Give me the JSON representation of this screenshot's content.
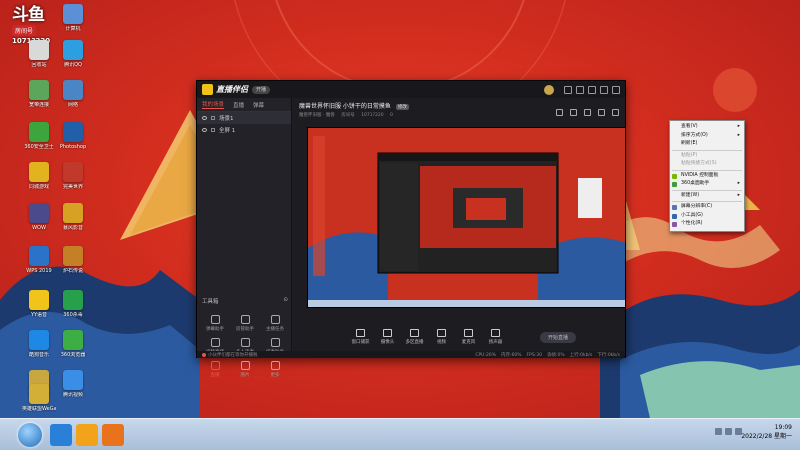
{
  "overlay": {
    "brand": "斗鱼",
    "room_tag": "房间号",
    "room_number": "1071?220"
  },
  "desktop_icons": [
    {
      "label": "计算机",
      "color": "#5b8fd6"
    },
    {
      "label": "回收站",
      "color": "#d9d9d9"
    },
    {
      "label": "腾讯QQ",
      "color": "#2d9ee0"
    },
    {
      "label": "宽带连接",
      "color": "#5aa65a"
    },
    {
      "label": "网络",
      "color": "#4a86c6"
    },
    {
      "label": "360安全卫士",
      "color": "#3ca53c"
    },
    {
      "label": "Photoshop",
      "color": "#2160a8"
    },
    {
      "label": "同城游戏",
      "color": "#e0b31f"
    },
    {
      "label": "完美世界",
      "color": "#c0392b"
    },
    {
      "label": "WOW",
      "color": "#4a4a8c"
    },
    {
      "label": "暴风影音",
      "color": "#d7a223"
    },
    {
      "label": "WPS 2019",
      "color": "#2a73c9"
    },
    {
      "label": "炉石传说",
      "color": "#c47f27"
    },
    {
      "label": "YY语音",
      "color": "#f0c419"
    },
    {
      "label": "360杀毒",
      "color": "#27a04c"
    },
    {
      "label": "酷狗音乐",
      "color": "#1e88e5"
    },
    {
      "label": "360浏览器",
      "color": "#3dae43"
    },
    {
      "label": "英雄联盟",
      "color": "#c9a640"
    },
    {
      "label": "腾讯视频",
      "color": "#3a8ee6"
    },
    {
      "label": "迅雷",
      "color": "#2a6ed1"
    },
    {
      "label": "英雄联盟WeGame",
      "color": "#d4af37"
    }
  ],
  "app": {
    "name": "直播伴侣",
    "pill": "开播",
    "tabs": [
      "我的场景",
      "直播",
      "弹幕"
    ],
    "scenes": [
      "场景1",
      "全屏 1"
    ],
    "tools_header": "工具箱",
    "tools": [
      {
        "label": "弹幕助手",
        "red": false
      },
      {
        "label": "房管助手",
        "red": false
      },
      {
        "label": "主播任务",
        "red": false
      },
      {
        "label": "视频直播",
        "red": false
      },
      {
        "label": "多人连麦",
        "red": false
      },
      {
        "label": "排麦助手",
        "red": false
      },
      {
        "label": "直播",
        "red": true
      },
      {
        "label": "图片",
        "red": false
      },
      {
        "label": "更多",
        "red": false
      }
    ],
    "room_title": "魔兽世界怀旧服  小饼干的日常摸鱼",
    "room_badge": "修改",
    "room_category": "魔兽怀旧服 · 魔兽",
    "room_id_label": "房间号",
    "room_id": "1071?220",
    "viewer_count": "0",
    "preview_buttons": [
      "窗口捕获",
      "摄像头",
      "多区直播",
      "视频",
      "麦克风",
      "扬声器"
    ],
    "go_live": "开始直播",
    "status_left": "小伙伴们都在等你开播啦",
    "status_stats": [
      "CPU:26%",
      "内存:60%",
      "FPS:30",
      "丢帧:0%",
      "上行:0kb/s",
      "下行:0kb/s"
    ]
  },
  "context_menu": {
    "items": [
      {
        "label": "查看(V)",
        "arrow": true,
        "disabled": false
      },
      {
        "label": "排序方式(O)",
        "arrow": true,
        "disabled": false
      },
      {
        "label": "刷新(E)",
        "arrow": false,
        "disabled": false
      },
      {
        "sep": true
      },
      {
        "label": "粘贴(P)",
        "arrow": false,
        "disabled": true
      },
      {
        "label": "粘贴快捷方式(S)",
        "arrow": false,
        "disabled": true
      },
      {
        "sep": true
      },
      {
        "label": "NVIDIA 控制面板",
        "arrow": false,
        "disabled": false,
        "icon": "#76b900"
      },
      {
        "label": "360桌面助手",
        "arrow": true,
        "disabled": false,
        "icon": "#3aa13a"
      },
      {
        "sep": true
      },
      {
        "label": "新建(W)",
        "arrow": true,
        "disabled": false
      },
      {
        "sep": true
      },
      {
        "label": "屏幕分辨率(C)",
        "arrow": false,
        "disabled": false,
        "icon": "#5577aa"
      },
      {
        "label": "小工具(G)",
        "arrow": false,
        "disabled": false,
        "icon": "#3366aa"
      },
      {
        "label": "个性化(R)",
        "arrow": false,
        "disabled": false,
        "icon": "#8855aa"
      }
    ]
  },
  "taskbar": {
    "apps": [
      {
        "name": "ie",
        "color": "#2a7fd8"
      },
      {
        "name": "douyu",
        "color": "#f3a21c"
      },
      {
        "name": "live-companion",
        "color": "#e8731c"
      }
    ],
    "time": "19:09",
    "date": "2022/2/28 星期一"
  },
  "colors": {
    "accent": "#e9534a",
    "wallpaper": "#d42e1f"
  }
}
